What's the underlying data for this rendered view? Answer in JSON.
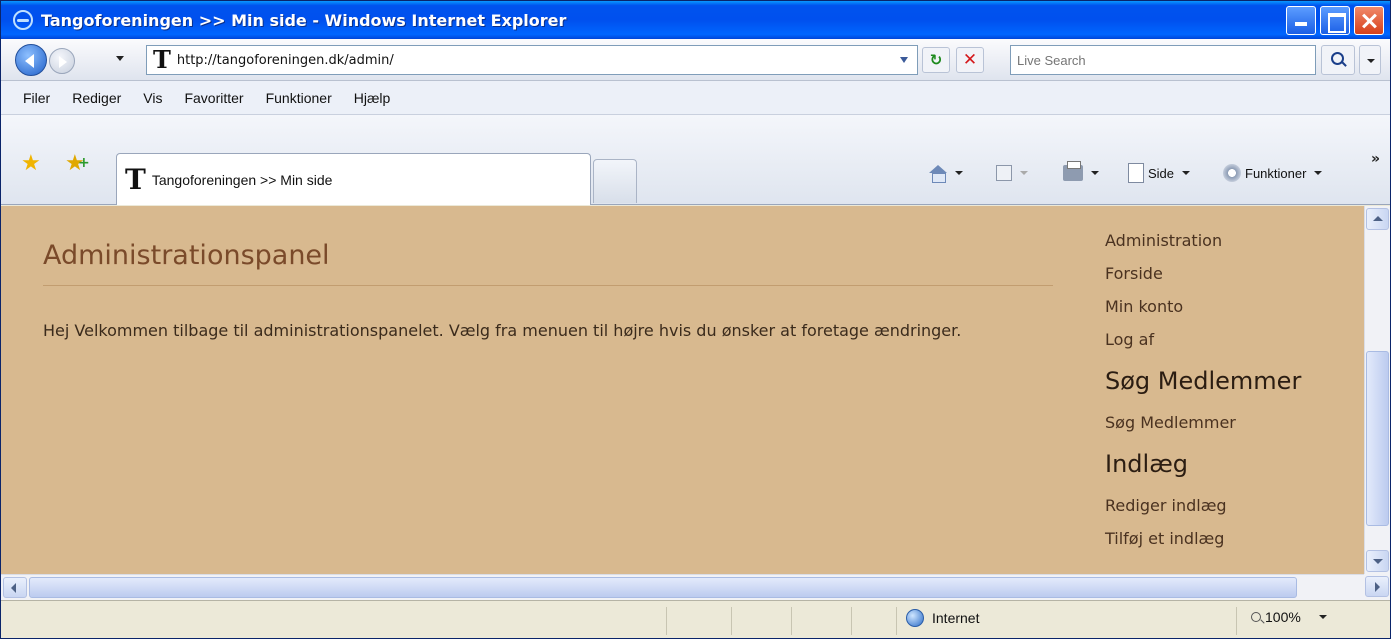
{
  "window": {
    "title": "Tangoforeningen >> Min side - Windows Internet Explorer"
  },
  "address": {
    "url": "http://tangoforeningen.dk/admin/",
    "search_placeholder": "Live Search"
  },
  "site_icon_letter": "T",
  "menubar": {
    "items": [
      "Filer",
      "Rediger",
      "Vis",
      "Favoritter",
      "Funktioner",
      "Hjælp"
    ]
  },
  "tab": {
    "label": "Tangoforeningen >> Min side"
  },
  "commandbar": {
    "page_label": "Side",
    "tools_label": "Funktioner",
    "overflow": "»"
  },
  "page": {
    "heading": "Administrationspanel",
    "welcome_text": "Hej    Velkommen tilbage til administrationspanelet. Vælg fra menuen til højre hvis du ønsker at foretage ændringer."
  },
  "sidenav": {
    "links_top": [
      "Administration",
      "Forside",
      "Min konto",
      "Log af"
    ],
    "section_search": "Søg Medlemmer",
    "search_links": [
      "Søg Medlemmer"
    ],
    "section_posts": "Indlæg",
    "posts_links": [
      "Rediger indlæg",
      "Tilføj et indlæg"
    ]
  },
  "statusbar": {
    "zone": "Internet",
    "zoom": "100%"
  },
  "colors": {
    "page_background": "#d8b98f",
    "heading_color": "#7a4a2a",
    "titlebar_blue": "#0053ee"
  }
}
